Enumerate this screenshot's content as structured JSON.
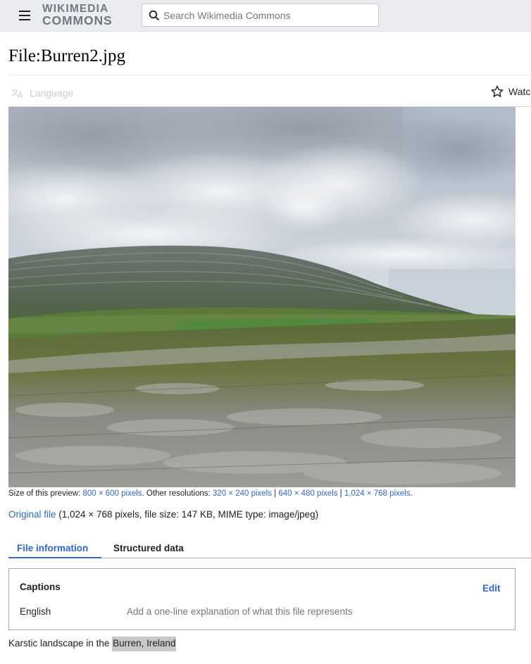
{
  "header": {
    "logo_line1": "WIKIMEDIA",
    "logo_line2": "COMMONS",
    "search_placeholder": "Search Wikimedia Commons",
    "icons": [
      "menu-icon",
      "search-icon"
    ]
  },
  "page": {
    "title": "File:Burren2.jpg"
  },
  "toolbar": {
    "language_label": "Language",
    "watch_label": "Watch",
    "icons": [
      "language-icon",
      "star-icon"
    ]
  },
  "image": {
    "alt": "Karstic landscape in the Burren, Ireland"
  },
  "resolutions": {
    "preview_prefix": "Size of this preview: ",
    "preview_link": "800 × 600 pixels",
    "other_prefix": ". Other resolutions: ",
    "res1": "320 × 240 pixels",
    "sep1": " | ",
    "res2": "640 × 480 pixels",
    "sep2": " | ",
    "res3": "1,024 × 768 pixels",
    "suffix": "."
  },
  "original": {
    "link": "Original file",
    "details": " (1,024 × 768 pixels, file size: 147 KB, MIME type: image/jpeg)"
  },
  "tabs": {
    "file_information": "File information",
    "structured_data": "Structured data"
  },
  "captions": {
    "heading": "Captions",
    "edit": "Edit",
    "language": "English",
    "placeholder": "Add a one-line explanation of what this file represents"
  },
  "description": {
    "text": "Karstic landscape in the ",
    "highlight": "Burren, Ireland"
  },
  "colors": {
    "header_bg": "#eaecf0",
    "link": "#3366cc",
    "text": "#202122",
    "muted": "#72777d"
  }
}
